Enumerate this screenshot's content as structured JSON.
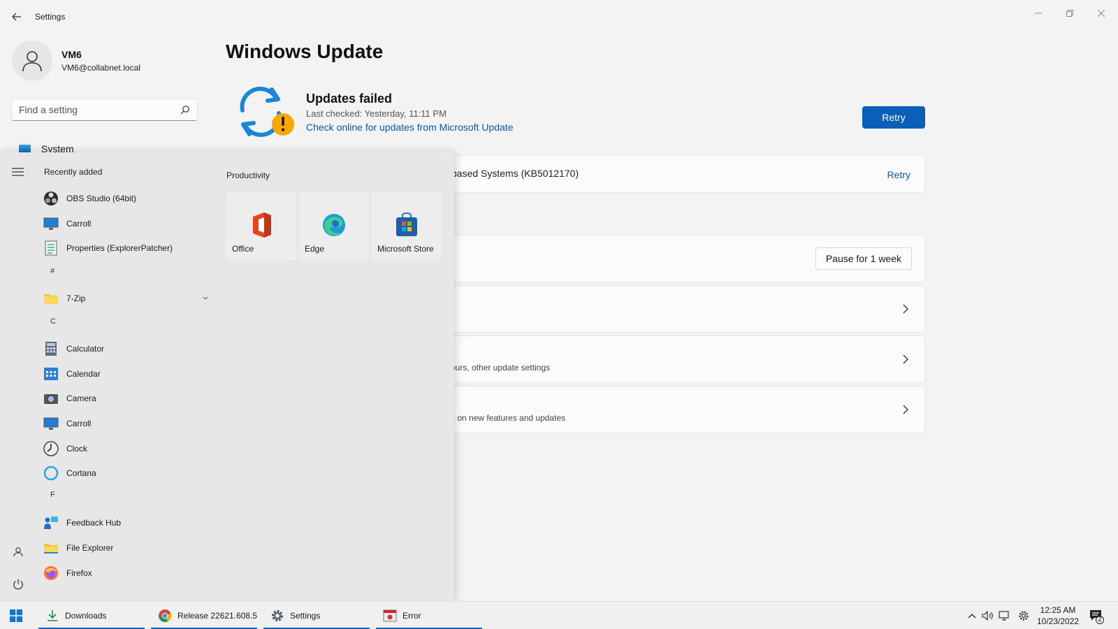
{
  "window": {
    "app_title": "Settings",
    "back_label": "←"
  },
  "profile": {
    "name": "VM6",
    "email": "VM6@collabnet.local"
  },
  "search": {
    "placeholder": "Find a setting"
  },
  "nav": {
    "system_label": "System"
  },
  "page": {
    "title": "Windows Update"
  },
  "status": {
    "title": "Updates failed",
    "last_checked": "Last checked: Yesterday, 11:11 PM",
    "link": "Check online for updates from Microsoft Update",
    "retry_label": "Retry"
  },
  "cards": {
    "kb_text": "based Systems (KB5012170)",
    "kb_retry": "Retry",
    "pause_label": "Pause for 1 week",
    "advanced_sub": "ours, other update settings",
    "insider_sub": "k on new features and updates"
  },
  "start_menu": {
    "recently_added_label": "Recently added",
    "recent": [
      "OBS Studio (64bit)",
      "Carroll",
      "Properties (ExplorerPatcher)"
    ],
    "letters": [
      "#",
      "C",
      "F"
    ],
    "hash_apps": [
      "7-Zip"
    ],
    "c_apps": [
      "Calculator",
      "Calendar",
      "Camera",
      "Carroll",
      "Clock",
      "Cortana"
    ],
    "f_apps": [
      "Feedback Hub",
      "File Explorer",
      "Firefox"
    ],
    "group_title": "Productivity",
    "tiles": [
      "Office",
      "Edge",
      "Microsoft Store"
    ]
  },
  "taskbar": {
    "items": [
      "Downloads",
      "Release 22621.608.5...",
      "Settings",
      "Error"
    ],
    "time": "12:25 AM",
    "date": "10/23/2022",
    "notification_count": "2"
  },
  "colors": {
    "accent": "#0a5fb8",
    "link": "#0a5aa8",
    "warning": "#f7a800"
  }
}
